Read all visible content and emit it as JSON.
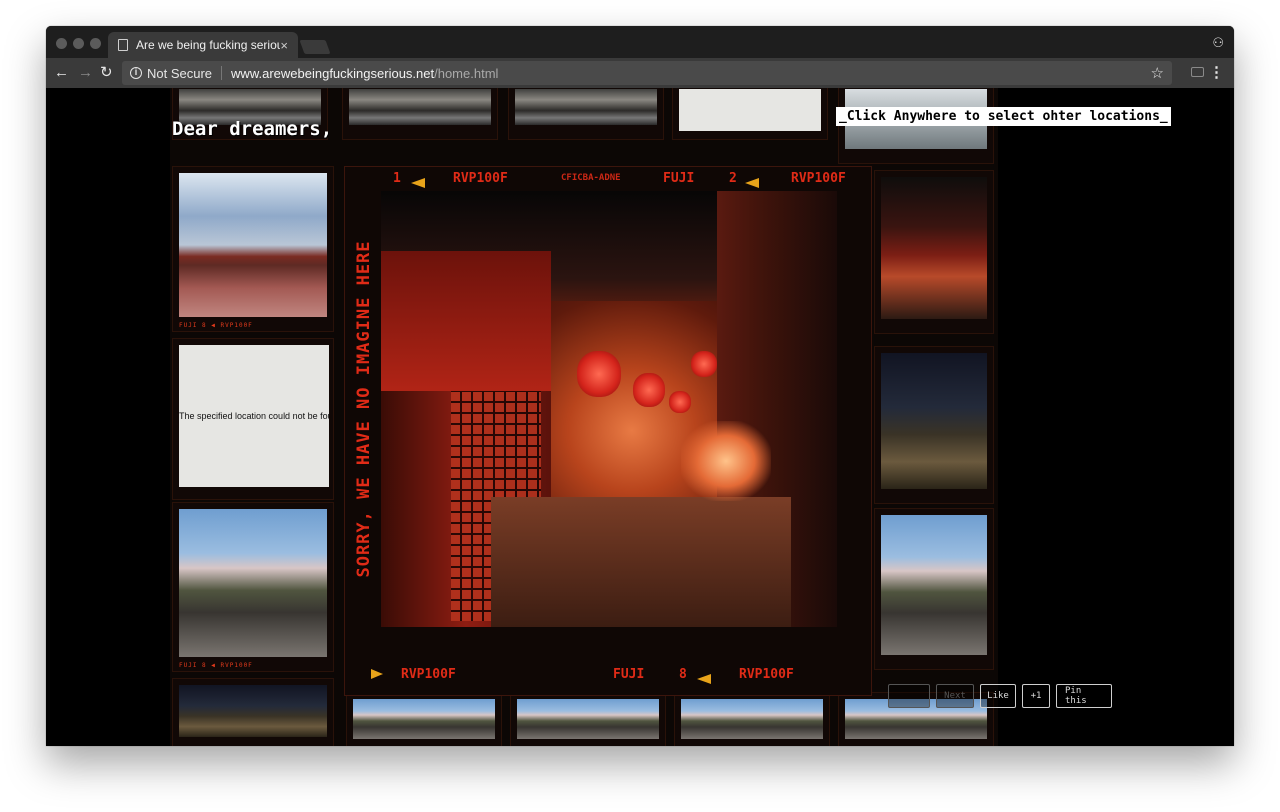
{
  "browser": {
    "tab_title": "Are we being fucking serious?",
    "tab_close": "×",
    "not_secure": "Not Secure",
    "url_host": "www.arewebeingfuckingserious.net",
    "url_path": "/home.html",
    "nav": {
      "back": "←",
      "forward": "→",
      "reload": "↻"
    },
    "star": "☆",
    "menu": "⋮",
    "incognito": "⚇"
  },
  "page": {
    "greeting": "Dear dreamers,",
    "hint": "_Click Anywhere to select ohter locations_",
    "error_message": "The specified location could not be found",
    "main_frame": {
      "top_left_num": "1",
      "top_film_1": "RVP100F",
      "top_brand_mid": "CFICBA-ADNE",
      "top_brand": "FUJI",
      "top_right_num": "2",
      "top_film_2": "RVP100F",
      "bottom_film_1": "RVP100F",
      "bottom_brand": "FUJI",
      "bottom_num": "8",
      "bottom_film_2": "RVP100F",
      "vertical_text": "SORRY, WE HAVE NO IMAGINE HERE"
    },
    "edge_text": "FUJI 8 ◀ RVP100F",
    "buttons": [
      {
        "label": "",
        "dim": true
      },
      {
        "label": "Next",
        "dim": true
      },
      {
        "label": "Like",
        "dim": false
      },
      {
        "label": "+1",
        "dim": false
      },
      {
        "label": "Pin this",
        "dim": false
      }
    ],
    "colors": {
      "film_red": "#e02b17",
      "film_amber": "#e8a31a",
      "background": "#000000"
    }
  }
}
